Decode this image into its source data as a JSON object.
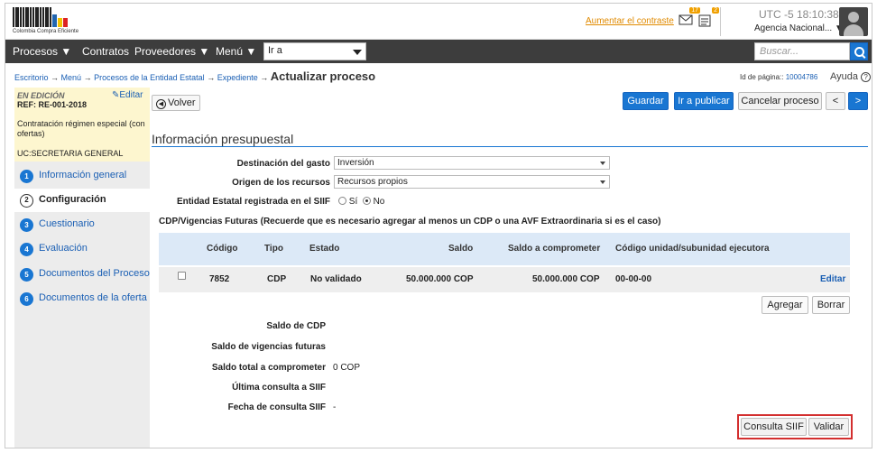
{
  "header": {
    "logo_caption": "Colombia Compra Eficiente",
    "contrast_link": "Aumentar el contraste",
    "messages_badge": "17",
    "notifications_badge": "2",
    "clock": "UTC -5 18:10:38",
    "agency": "Agencia Nacional..."
  },
  "nav": {
    "items": [
      "Procesos",
      "Contratos",
      "Proveedores",
      "Menú"
    ],
    "goto_value": "Ir a",
    "search_placeholder": "Buscar..."
  },
  "breadcrumb": {
    "items": [
      "Escritorio",
      "Menú",
      "Procesos de la Entidad Estatal",
      "Expediente"
    ],
    "separator": "→",
    "current": "Actualizar proceso"
  },
  "page_meta": {
    "page_id_label": "Id de página::",
    "page_id": "10004786",
    "help": "Ayuda"
  },
  "sidebar": {
    "status": "EN EDICIÓN",
    "edit": "Editar",
    "ref": "REF: RE-001-2018",
    "modality": "Contratación régimen especial (con ofertas)",
    "unit": "UC:SECRETARIA GENERAL",
    "steps": [
      {
        "num": "1",
        "label": "Información general"
      },
      {
        "num": "2",
        "label": "Configuración"
      },
      {
        "num": "3",
        "label": "Cuestionario"
      },
      {
        "num": "4",
        "label": "Evaluación"
      },
      {
        "num": "5",
        "label": "Documentos del Proceso"
      },
      {
        "num": "6",
        "label": "Documentos de la oferta"
      }
    ]
  },
  "toolbar": {
    "back": "Volver",
    "save": "Guardar",
    "publish": "Ir a publicar",
    "cancel": "Cancelar proceso",
    "prev": "<",
    "next": ">"
  },
  "section": {
    "title": "Información presupuestal",
    "destino_label": "Destinación del gasto",
    "destino_value": "Inversión",
    "origen_label": "Origen de los recursos",
    "origen_value": "Recursos propios",
    "siif_label": "Entidad Estatal registrada en el SIIF",
    "siif_yes": "Sí",
    "siif_no": "No",
    "siif_selected": "No",
    "cdp_title": "CDP/Vigencias Futuras (Recuerde que es necesario agregar al menos un CDP o una AVF Extraordinaria si es el caso)"
  },
  "table": {
    "headers": [
      "Código",
      "Tipo",
      "Estado",
      "Saldo",
      "Saldo a comprometer",
      "Código unidad/subunidad ejecutora"
    ],
    "rows": [
      {
        "codigo": "7852",
        "tipo": "CDP",
        "estado": "No validado",
        "saldo": "50.000.000 COP",
        "saldo_comprometer": "50.000.000 COP",
        "unidad": "00-00-00",
        "action": "Editar"
      }
    ],
    "add": "Agregar",
    "delete": "Borrar"
  },
  "summary": {
    "saldo_cdp_label": "Saldo de CDP",
    "saldo_cdp_value": "",
    "saldo_vigencias_label": "Saldo de vigencias futuras",
    "saldo_vigencias_value": "",
    "saldo_total_label": "Saldo total a comprometer",
    "saldo_total_value": "0 COP",
    "ultima_consulta_label": "Última consulta a SIIF",
    "ultima_consulta_value": "",
    "fecha_consulta_label": "Fecha de consulta SIIF",
    "fecha_consulta_value": "-"
  },
  "actions": {
    "consulta_siif": "Consulta SIIF",
    "validar": "Validar"
  },
  "colors": {
    "primary": "#1976d2",
    "navbar": "#3d3d3d",
    "edit_box": "#fdf6cf",
    "table_header": "#dce9f7",
    "highlight": "#d32f2f"
  }
}
